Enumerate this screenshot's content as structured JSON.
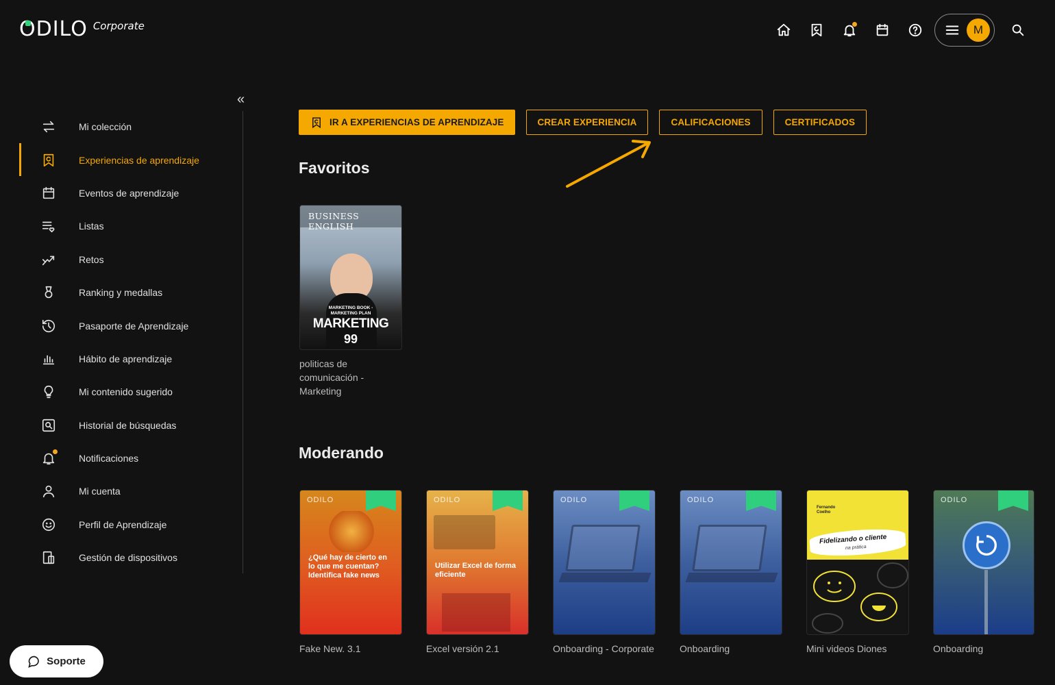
{
  "header": {
    "logo_text": "ODILO",
    "logo_sub": "Corporate",
    "avatar_initial": "M",
    "icons": [
      "home-icon",
      "bookmark-icon",
      "bell-icon",
      "calendar-icon",
      "help-icon",
      "menu-icon",
      "search-icon"
    ]
  },
  "sidebar": {
    "collapse_label": "«",
    "items": [
      {
        "label": "Mi colección",
        "icon": "swap-icon"
      },
      {
        "label": "Experiencias de aprendizaje",
        "icon": "learning-bookmark-icon",
        "active": true
      },
      {
        "label": "Eventos de aprendizaje",
        "icon": "calendar-icon"
      },
      {
        "label": "Listas",
        "icon": "list-heart-icon"
      },
      {
        "label": "Retos",
        "icon": "challenge-icon"
      },
      {
        "label": "Ranking y medallas",
        "icon": "medal-icon"
      },
      {
        "label": "Pasaporte de Aprendizaje",
        "icon": "history-icon"
      },
      {
        "label": "Hábito de aprendizaje",
        "icon": "bar-chart-icon"
      },
      {
        "label": "Mi contenido sugerido",
        "icon": "lightbulb-icon"
      },
      {
        "label": "Historial de búsquedas",
        "icon": "search-history-icon"
      },
      {
        "label": "Notificaciones",
        "icon": "bell-icon"
      },
      {
        "label": "Mi cuenta",
        "icon": "user-icon"
      },
      {
        "label": "Perfil de Aprendizaje",
        "icon": "smile-icon"
      },
      {
        "label": "Gestión de dispositivos",
        "icon": "devices-icon"
      }
    ]
  },
  "actions": {
    "go_experiences": "IR A EXPERIENCIAS DE APRENDIZAJE",
    "create": "CREAR EXPERIENCIA",
    "grades": "CALIFICACIONES",
    "certificates": "CERTIFICADOS"
  },
  "favorites": {
    "title": "Favoritos",
    "cards": [
      {
        "title": "politicas de comunicación - Marketing",
        "cover_top": "BUSINESS ENGLISH",
        "cover_sub": "MARKETING BOOK - MARKETING PLAN",
        "cover_main": "MARKETING",
        "cover_num": "99"
      }
    ]
  },
  "moderating": {
    "title": "Moderando",
    "cards": [
      {
        "title": "Fake New. 3.1",
        "cover_text": "¿Qué hay de cierto en lo que me cuentan? Identifica fake news",
        "colors": [
          "#d6871c",
          "#e0301e"
        ]
      },
      {
        "title": "Excel versión 2.1",
        "cover_text": "Utilizar Excel de forma eficiente",
        "colors": [
          "#e0a83a",
          "#d8302a"
        ]
      },
      {
        "title": "Onboarding - Corporate",
        "cover_text": "",
        "colors": [
          "#5b7fb8",
          "#1d3e86"
        ]
      },
      {
        "title": "Onboarding",
        "cover_text": "",
        "colors": [
          "#5b7fb8",
          "#1d3e86"
        ]
      },
      {
        "title": "Mini videos Diones",
        "cover_author": "Fernando Coelho",
        "cover_text": "Fidelizando o cliente",
        "cover_sub": "na prática",
        "colors": [
          "#f2e236",
          "#151515"
        ]
      },
      {
        "title": "Onboarding",
        "cover_text": "",
        "colors": [
          "#4f7a55",
          "#1b3d8a"
        ]
      }
    ]
  },
  "support": {
    "label": "Soporte"
  }
}
